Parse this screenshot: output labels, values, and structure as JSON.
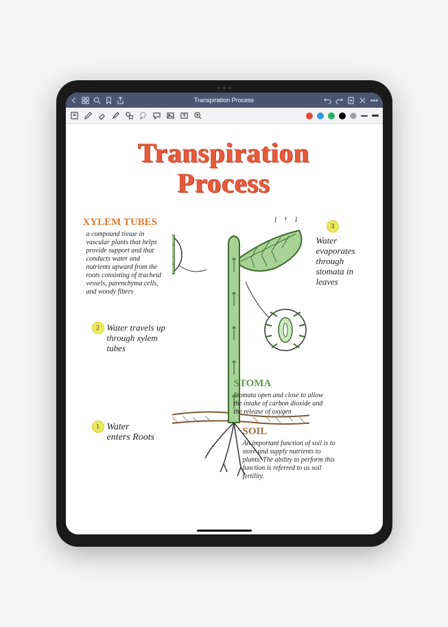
{
  "header": {
    "title": "Transpiration Process"
  },
  "note": {
    "title_line1": "Transpiration",
    "title_line2": "Process",
    "sections": {
      "xylem": {
        "heading": "XYLEM TUBES",
        "desc": "a compound tissue in vascular plants that helps provide support and that conducts water and nutrients upward from the roots consisting of tracheid vessels, parenchyma cells, and woody fibers"
      },
      "stoma": {
        "heading": "STOMA",
        "desc": "Stomata open and close to allow the intake of carbon dioxide and the release of oxygen"
      },
      "soil": {
        "heading": "SOIL",
        "desc": "An important function of soil is to store and supply nutrients to plants. The ability to perform this function is referred to as soil fertility."
      }
    },
    "steps": {
      "s1": {
        "num": "1",
        "text": "Water enters Roots"
      },
      "s2": {
        "num": "2",
        "text": "Water travels up through xylem tubes"
      },
      "s3": {
        "num": "3",
        "text": "Water evaporates through stomata in leaves"
      }
    }
  },
  "colors": {
    "accent_orange": "#e55a3c",
    "toolbar_bg": "#4a5574"
  }
}
